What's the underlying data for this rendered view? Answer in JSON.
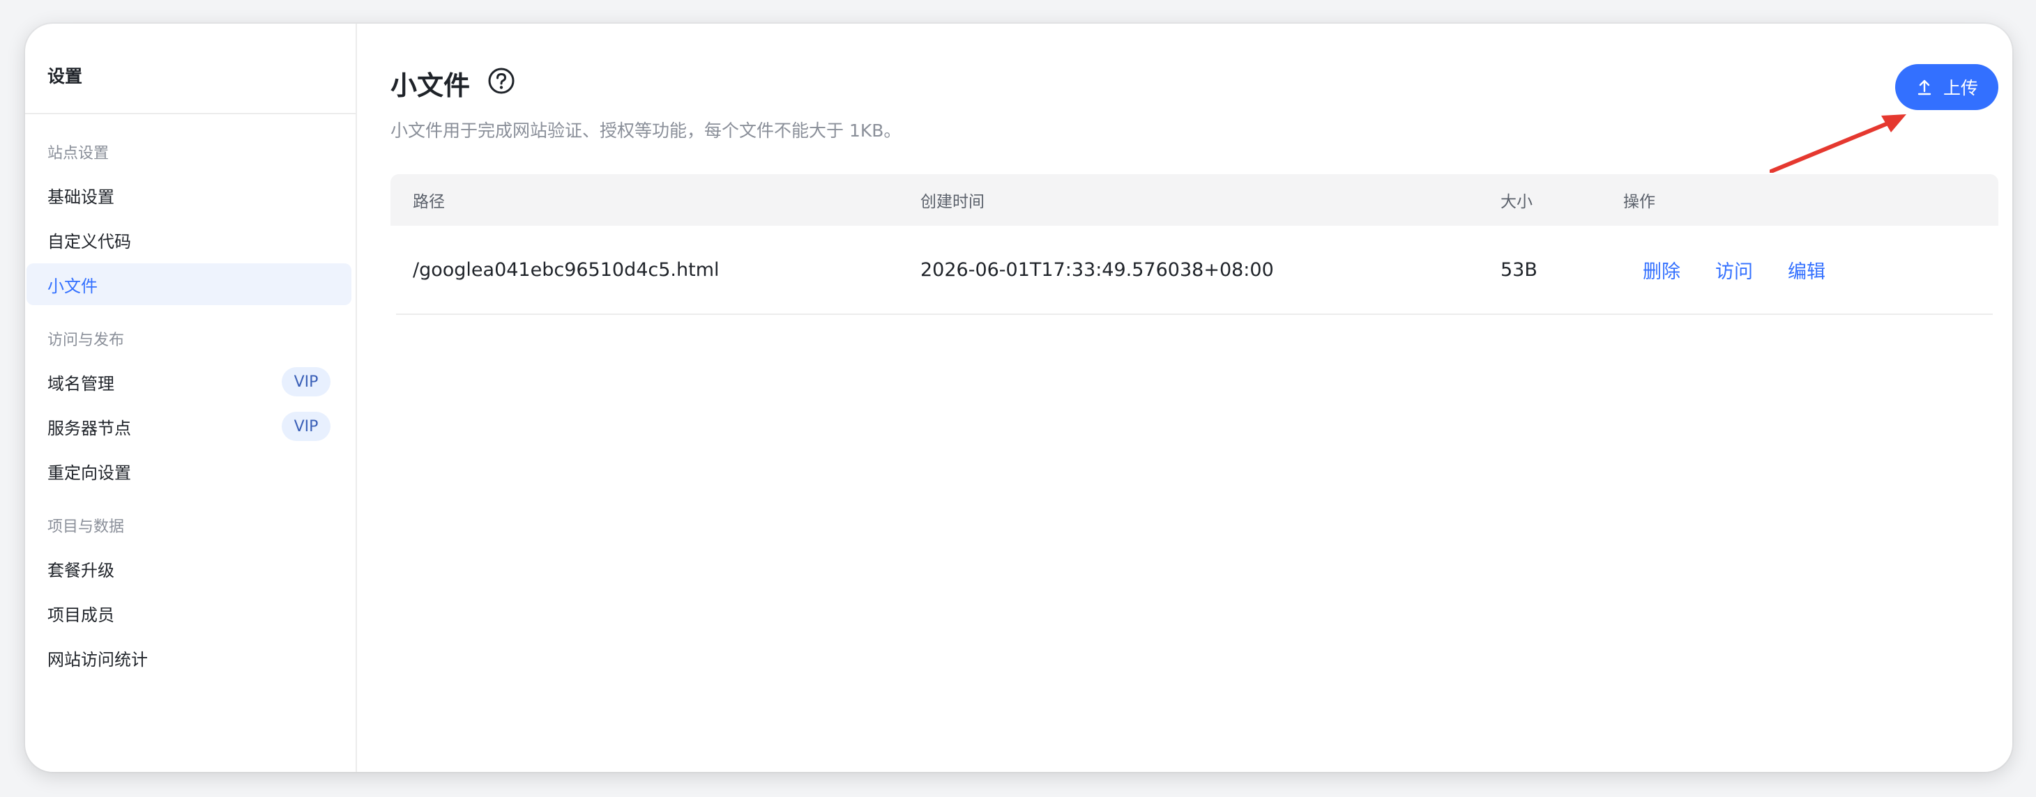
{
  "sidebar": {
    "title": "设置",
    "sections": [
      {
        "label": "站点设置",
        "items": [
          {
            "label": "基础设置"
          },
          {
            "label": "自定义代码"
          },
          {
            "label": "小文件",
            "active": true
          }
        ]
      },
      {
        "label": "访问与发布",
        "items": [
          {
            "label": "域名管理",
            "badge": "VIP"
          },
          {
            "label": "服务器节点",
            "badge": "VIP"
          },
          {
            "label": "重定向设置"
          }
        ]
      },
      {
        "label": "项目与数据",
        "items": [
          {
            "label": "套餐升级"
          },
          {
            "label": "项目成员"
          },
          {
            "label": "网站访问统计"
          }
        ]
      }
    ]
  },
  "main": {
    "title": "小文件",
    "help_icon": "question-circle-icon",
    "subtitle": "小文件用于完成网站验证、授权等功能，每个文件不能大于 1KB。",
    "upload_button": {
      "label": "上传",
      "icon": "upload-icon"
    },
    "table": {
      "columns": [
        "路径",
        "创建时间",
        "大小",
        "操作"
      ],
      "rows": [
        {
          "path": "/googlea041ebc96510d4c5.html",
          "created": "2026-06-01T17:33:49.576038+08:00",
          "size": "53B",
          "actions": [
            "删除",
            "访问",
            "编辑"
          ]
        }
      ]
    }
  },
  "colors": {
    "accent": "#3370ff",
    "annotation_arrow": "#e5382f",
    "active_bg": "#eef3fd",
    "vip_bg": "#e8f0fe"
  }
}
